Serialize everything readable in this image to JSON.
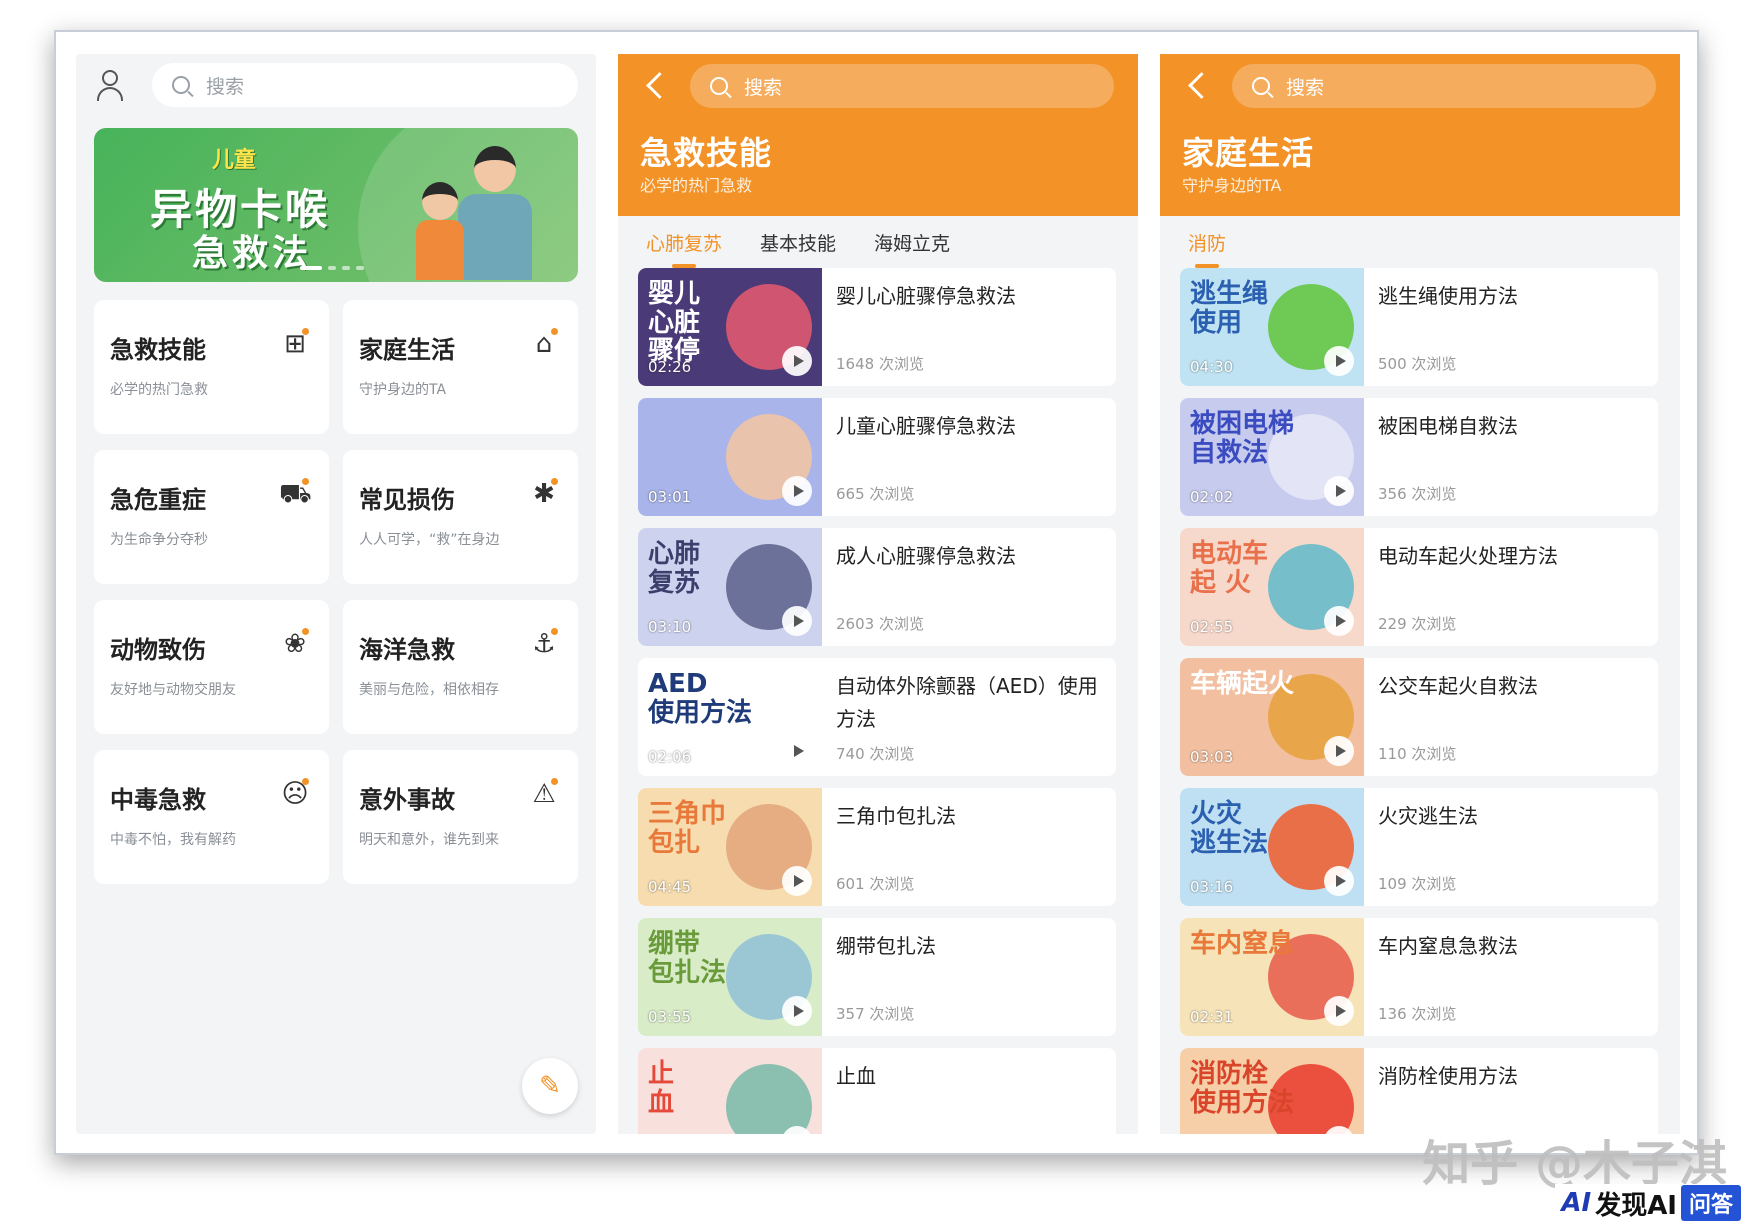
{
  "colors": {
    "accent": "#f29227",
    "banner_green": "#47b35a"
  },
  "home": {
    "search_placeholder": "搜索",
    "banner": {
      "tag": "儿童",
      "line1": "异物卡喉",
      "line2": "急救法"
    },
    "categories": [
      {
        "title": "急救技能",
        "subtitle": "必学的热门急救",
        "icon": "first-aid-kit-icon",
        "glyph": "⊞"
      },
      {
        "title": "家庭生活",
        "subtitle": "守护身边的TA",
        "icon": "home-plus-icon",
        "glyph": "⌂"
      },
      {
        "title": "急危重症",
        "subtitle": "为生命争分夺秒",
        "icon": "hospital-bed-icon",
        "glyph": "⛟"
      },
      {
        "title": "常见损伤",
        "subtitle": "人人可学，“救”在身边",
        "icon": "injured-person-icon",
        "glyph": "✱"
      },
      {
        "title": "动物致伤",
        "subtitle": "友好地与动物交朋友",
        "icon": "paw-icon",
        "glyph": "❀"
      },
      {
        "title": "海洋急救",
        "subtitle": "美丽与危险，相依相存",
        "icon": "lifebuoy-icon",
        "glyph": "⚓"
      },
      {
        "title": "中毒急救",
        "subtitle": "中毒不怕，我有解药",
        "icon": "skull-icon",
        "glyph": "☹"
      },
      {
        "title": "意外事故",
        "subtitle": "明天和意外，谁先到来",
        "icon": "warning-icon",
        "glyph": "⚠"
      }
    ]
  },
  "skills": {
    "search_placeholder": "搜索",
    "title": "急救技能",
    "subtitle": "必学的热门急救",
    "tabs": [
      "心肺复苏",
      "基本技能",
      "海姆立克"
    ],
    "items": [
      {
        "name": "婴儿心脏骤停急救法",
        "views": "1648 次浏览",
        "thumb_text": "婴儿\n心脏\n骤停",
        "duration": "02:26",
        "bg": "#4b3a78",
        "fg": "#ffffff",
        "art": "#e85a6e"
      },
      {
        "name": "儿童心脏骤停急救法",
        "views": "665 次浏览",
        "thumb_text": "",
        "duration": "03:01",
        "bg": "#a9b4ea",
        "fg": "#ffffff",
        "art": "#f5c6a0"
      },
      {
        "name": "成人心脏骤停急救法",
        "views": "2603 次浏览",
        "thumb_text": "心肺\n复苏",
        "duration": "03:10",
        "bg": "#cdd3ee",
        "fg": "#3b3f6b",
        "art": "#5b5f8b"
      },
      {
        "name": "自动体外除颤器（AED）使用方法",
        "views": "740 次浏览",
        "thumb_text": "AED\n使用方法",
        "duration": "02:06",
        "bg": "#ffffff",
        "fg": "#1f3b7a",
        "art": "#ffffff"
      },
      {
        "name": "三角巾包扎法",
        "views": "601 次浏览",
        "thumb_text": "三角巾\n包扎",
        "duration": "04:45",
        "bg": "#f6dcae",
        "fg": "#e8793a",
        "art": "#e3a37a"
      },
      {
        "name": "绷带包扎法",
        "views": "357 次浏览",
        "thumb_text": "绷带\n包扎法",
        "duration": "03:55",
        "bg": "#d9ecc8",
        "fg": "#6a9b3a",
        "art": "#8fc0d6"
      },
      {
        "name": "止血",
        "views": "",
        "thumb_text": "止\n血",
        "duration": "",
        "bg": "#f8e1dc",
        "fg": "#e4493a",
        "art": "#78b8a8"
      }
    ]
  },
  "family": {
    "search_placeholder": "搜索",
    "title": "家庭生活",
    "subtitle": "守护身边的TA",
    "tabs": [
      "消防"
    ],
    "items": [
      {
        "name": "逃生绳使用方法",
        "views": "500 次浏览",
        "thumb_text": "逃生绳\n使用",
        "duration": "04:30",
        "bg": "#bfe3f2",
        "fg": "#2b5fb0",
        "art": "#5fc43a"
      },
      {
        "name": "被困电梯自救法",
        "views": "356 次浏览",
        "thumb_text": "被困电梯\n自救法",
        "duration": "02:02",
        "bg": "#c7cbee",
        "fg": "#3b4cc0",
        "art": "#e8eaf8"
      },
      {
        "name": "电动车起火处理方法",
        "views": "229 次浏览",
        "thumb_text": "电动车\n起 火",
        "duration": "02:55",
        "bg": "#f7d9cc",
        "fg": "#e8704a",
        "art": "#5fb8c8"
      },
      {
        "name": "公交车起火自救法",
        "views": "110 次浏览",
        "thumb_text": "车辆起火",
        "duration": "03:03",
        "bg": "#f2c0a0",
        "fg": "#ffffff",
        "art": "#e8a03a"
      },
      {
        "name": "火灾逃生法",
        "views": "109 次浏览",
        "thumb_text": "火灾\n逃生法",
        "duration": "03:16",
        "bg": "#bfe0f2",
        "fg": "#2b5fb0",
        "art": "#f05a2a"
      },
      {
        "name": "车内窒息急救法",
        "views": "136 次浏览",
        "thumb_text": "车内窒息",
        "duration": "02:31",
        "bg": "#f6e3b8",
        "fg": "#e8793a",
        "art": "#e85a4a"
      },
      {
        "name": "消防栓使用方法",
        "views": "",
        "thumb_text": "消防栓\n使用方法",
        "duration": "",
        "bg": "#f6cfa8",
        "fg": "#d9452a",
        "art": "#e83a2a"
      }
    ]
  },
  "watermark": "知乎 @木子淇",
  "brand": {
    "word": "发现AI",
    "qa": "问答"
  }
}
